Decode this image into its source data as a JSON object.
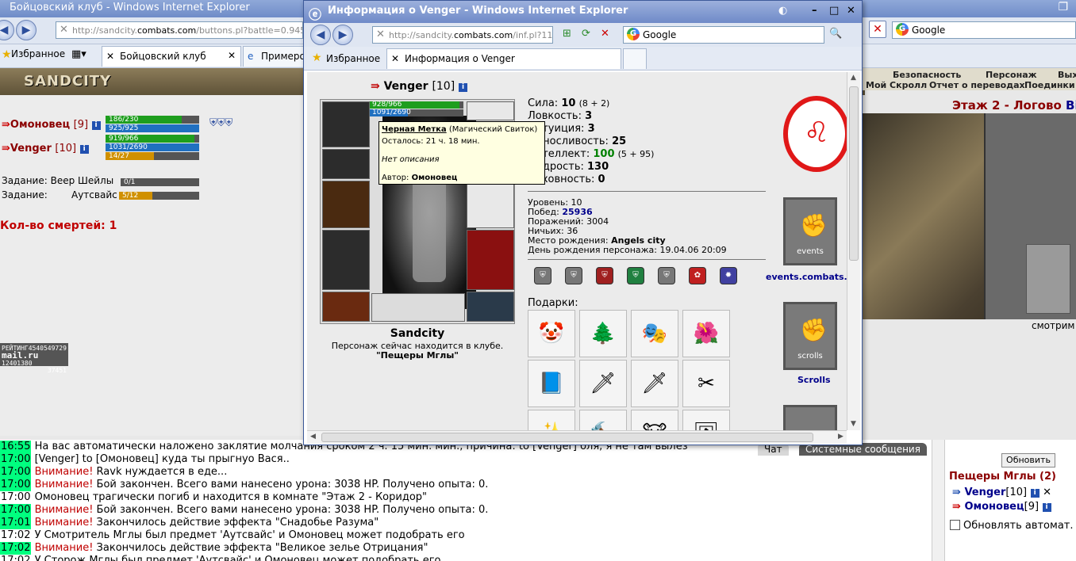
{
  "bg_window": {
    "title": "Бойцовский клуб - Windows Internet Explorer",
    "address_prefix": "http://sandcity.",
    "address_domain": "combats.com",
    "address_suffix": "/buttons.pl?battle=0.9455224",
    "search_label": "Google",
    "favorites_label": "Избранное",
    "tab1": "Бойцовский клуб",
    "tab2": "Примерочн"
  },
  "game": {
    "logo": "SANDCITY",
    "players": [
      {
        "name": "Омоновец",
        "level": "[9]"
      },
      {
        "name": "Venger",
        "level": "[10]"
      }
    ],
    "bars": [
      {
        "text": "186/230",
        "fill": 0.81,
        "color": "#1e9e1e"
      },
      {
        "text": "925/925",
        "fill": 1.0,
        "color": "#2070c0"
      },
      {
        "text": "919/966",
        "fill": 0.95,
        "color": "#1e9e1e"
      },
      {
        "text": "1031/2690",
        "fill": 1.0,
        "color": "#2070c0"
      },
      {
        "text": "14/27",
        "fill": 0.52,
        "color": "#d09000"
      }
    ],
    "task1_label": "Задание: Веер Шейлы",
    "task1_progress": "0/1",
    "task1_fill": 0.0,
    "task2_label": "Задание:",
    "task2_item": "Аутсвайс",
    "task2_progress": "5/12",
    "task2_fill": 0.42,
    "deaths": "Кол-во смертей: 1",
    "counter_l1": "РЕЙТИНГ",
    "counter_v1": "4540549729",
    "counter_v2": "12401380",
    "counter_v3": "37451",
    "counter_logo": "mail.ru"
  },
  "right_bg": {
    "menu": [
      "Безопасность",
      "Персонаж",
      "Вых"
    ],
    "submenu": [
      "Мой Скролл",
      "Отчет о переводах",
      "Поединки"
    ],
    "location": "Этаж 2 - Логово",
    "location_extra": "Ві",
    "look": "смотрим"
  },
  "chat": {
    "tabs": [
      "Чат",
      "Системные сообщения"
    ],
    "lines": [
      {
        "time": "16:55",
        "green": true,
        "text": "На вас автоматически наложено заклятие молчания сроком 2 ч. 15 мин. мин., причина: to [Venger] бля, я не там вылез"
      },
      {
        "time": "17:00",
        "green": true,
        "text": "[Venger] to [Омоновец] куда ты прыгнуо Вася.."
      },
      {
        "time": "17:00",
        "green": true,
        "warn": "Внимание!",
        "text": " Ravk нуждается в еде..."
      },
      {
        "time": "17:00",
        "green": true,
        "warn": "Внимание!",
        "text": " Бой закончен. Всего вами нанесено урона: 3038 HP. Получено опыта: 0."
      },
      {
        "time": "17:00",
        "green": false,
        "text": "Омоновец трагически погиб и находится в комнате \"Этаж 2 - Коридор\""
      },
      {
        "time": "17:00",
        "green": true,
        "warn": "Внимание!",
        "text": " Бой закончен. Всего вами нанесено урона: 3038 HP. Получено опыта: 0."
      },
      {
        "time": "17:01",
        "green": true,
        "warn": "Внимание!",
        "text": " Закончилось действие эффекта \"Снадобье Разума\""
      },
      {
        "time": "17:02",
        "green": false,
        "text": "У Смотритель Мглы был предмет 'Аутсвайс' и Омоновец может подобрать его"
      },
      {
        "time": "17:02",
        "green": true,
        "warn": "Внимание!",
        "text": " Закончилось действие эффекта \"Великое зелье Отрицания\""
      },
      {
        "time": "17:02",
        "green": false,
        "text": "У Сторож Мглы был предмет 'Аутсвайс' и Омоновец может подобрать его"
      }
    ]
  },
  "online": {
    "refresh": "Обновить",
    "room": "Пещеры Мглы (2)",
    "players": [
      {
        "name": "Venger",
        "level": "[10]"
      },
      {
        "name": "Омоновец",
        "level": "[9]"
      }
    ],
    "auto": "Обновлять автомат."
  },
  "popup": {
    "title": "Информация о Venger - Windows Internet Explorer",
    "address_prefix": "http://sandcity.",
    "address_domain": "combats.com",
    "address_suffix": "/inf.pl?11",
    "search_label": "Google",
    "favorites_label": "Избранное",
    "tab": "Информация о Venger",
    "char_name": "Venger",
    "char_level": "[10]",
    "hp": "928/966",
    "mana": "1091/2690",
    "stats": [
      {
        "label": "Сила:",
        "value": "10",
        "extra": "(8 + 2)"
      },
      {
        "label": "Ловкость:",
        "value": "3",
        "extra": ""
      },
      {
        "label": "Интуиция:",
        "value": "3",
        "extra": ""
      },
      {
        "label": "Выносливость:",
        "value": "25",
        "extra": ""
      },
      {
        "label": "Интеллект:",
        "value": "100",
        "extra": "(5 + 95)"
      },
      {
        "label": "Мудрость:",
        "value": "130",
        "extra": ""
      },
      {
        "label": "Духовность:",
        "value": "0",
        "extra": ""
      }
    ],
    "info": [
      {
        "label": "Уровень:",
        "value": "10",
        "hl": false
      },
      {
        "label": "Побед:",
        "value": "25936",
        "hl": true
      },
      {
        "label": "Поражений:",
        "value": "3004",
        "hl": false
      },
      {
        "label": "Ничьих:",
        "value": "36",
        "hl": false
      },
      {
        "label": "Место рождения:",
        "value": "Angels city",
        "hl": true
      },
      {
        "label": "День рождения персонажа:",
        "value": "19.04.06 20:09",
        "hl": false
      }
    ],
    "tooltip_name": "Черная Метка",
    "tooltip_type": "(Магический Свиток)",
    "tooltip_left": "Осталось: 21 ч. 18 мин.",
    "tooltip_desc": "Нет описания",
    "tooltip_author_label": "Автор:",
    "tooltip_author": "Омоновец",
    "club": "Sandcity",
    "location_line": "Персонаж сейчас находится в клубе.",
    "location_place": "\"Пещеры Мглы\"",
    "gifts_label": "Подарки:",
    "gifts": [
      "🤡",
      "🌲",
      "🎭",
      "🌺",
      "📘",
      "🗡",
      "🗡",
      "✂",
      "✨",
      "🔨",
      "🐮",
      "🖼"
    ],
    "banner1_text": "events",
    "banner1_link": "events.combats.c",
    "banner2_text": "scrolls",
    "banner2_link": "Scrolls"
  }
}
